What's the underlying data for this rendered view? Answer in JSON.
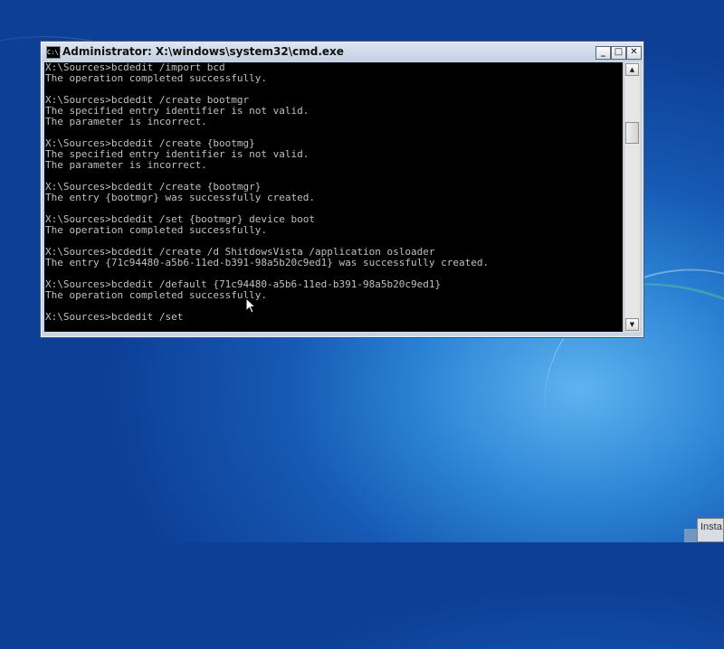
{
  "window": {
    "title": "Administrator: X:\\windows\\system32\\cmd.exe",
    "icon": "cmd-icon",
    "icon_text": "C:\\.",
    "buttons": {
      "minimize": "_",
      "maximize": "□",
      "close": "✕"
    }
  },
  "console": {
    "text": "X:\\Sources>bcdedit /import bcd\nThe operation completed successfully.\n\nX:\\Sources>bcdedit /create bootmgr\nThe specified entry identifier is not valid.\nThe parameter is incorrect.\n\nX:\\Sources>bcdedit /create {bootmg}\nThe specified entry identifier is not valid.\nThe parameter is incorrect.\n\nX:\\Sources>bcdedit /create {bootmgr}\nThe entry {bootmgr} was successfully created.\n\nX:\\Sources>bcdedit /set {bootmgr} device boot\nThe operation completed successfully.\n\nX:\\Sources>bcdedit /create /d ShitdowsVista /application osloader\nThe entry {71c94480-a5b6-11ed-b391-98a5b20c9ed1} was successfully created.\n\nX:\\Sources>bcdedit /default {71c94480-a5b6-11ed-b391-98a5b20c9ed1}\nThe operation completed successfully.\n\nX:\\Sources>bcdedit /set"
  },
  "scrollbar": {
    "up_arrow": "▲",
    "down_arrow": "▼"
  },
  "taskbar": {
    "install_button_label": "Insta"
  },
  "colors": {
    "console_background": "#000000",
    "console_text": "#c0c0c0",
    "titlebar": "#c9d6e5",
    "desktop": "#1659b4"
  }
}
